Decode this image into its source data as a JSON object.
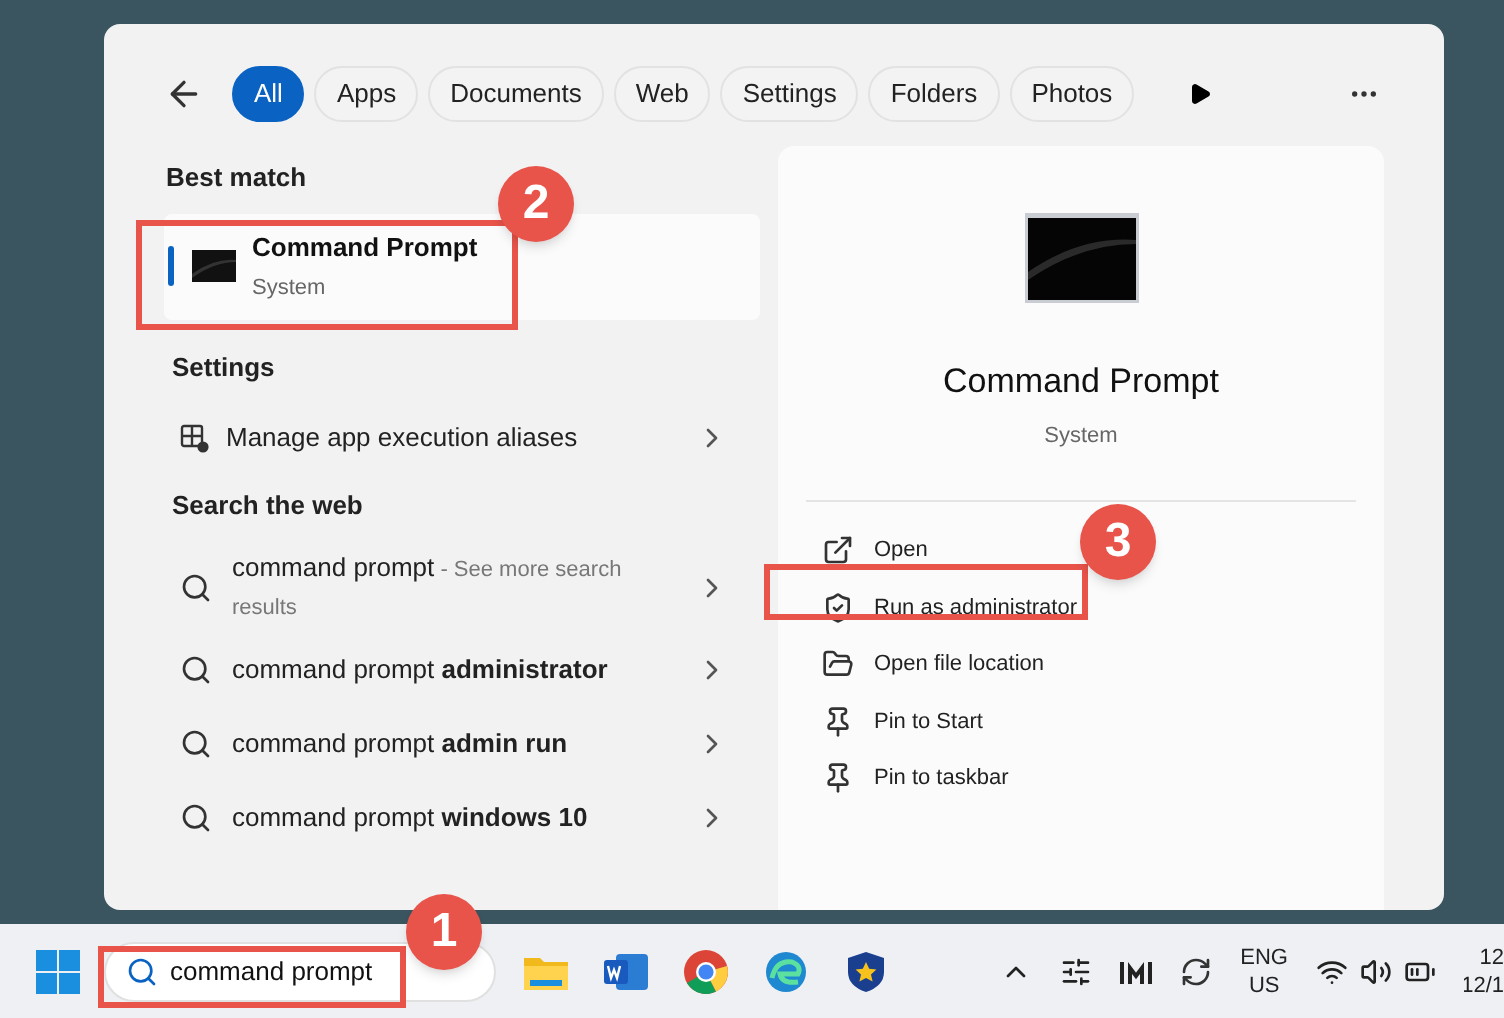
{
  "filters": [
    {
      "label": "All",
      "selected": true
    },
    {
      "label": "Apps",
      "selected": false
    },
    {
      "label": "Documents",
      "selected": false
    },
    {
      "label": "Web",
      "selected": false
    },
    {
      "label": "Settings",
      "selected": false
    },
    {
      "label": "Folders",
      "selected": false
    },
    {
      "label": "Photos",
      "selected": false
    }
  ],
  "best_match": {
    "heading": "Best match",
    "title": "Command Prompt",
    "subtitle": "System",
    "selected": true
  },
  "settings": {
    "heading": "Settings",
    "items": [
      {
        "label": "Manage app execution aliases"
      }
    ]
  },
  "web": {
    "heading": "Search the web",
    "items": [
      {
        "text": "command prompt",
        "hint": " - See more search results"
      },
      {
        "text": "command prompt **administrator**"
      },
      {
        "text": "command prompt **admin run**"
      },
      {
        "text": "command prompt **windows 10**"
      }
    ]
  },
  "details": {
    "title": "Command Prompt",
    "subtitle": "System",
    "actions": [
      {
        "kind": "open",
        "label": "Open"
      },
      {
        "kind": "admin",
        "label": "Run as administrator"
      },
      {
        "kind": "folder",
        "label": "Open file location"
      },
      {
        "kind": "pin",
        "label": "Pin to Start"
      },
      {
        "kind": "pin",
        "label": "Pin to taskbar"
      }
    ]
  },
  "taskbar": {
    "search_value": "command prompt",
    "language": [
      "ENG",
      "US"
    ],
    "clock": [
      "12",
      "12/1"
    ]
  },
  "callouts": [
    {
      "number": "1"
    },
    {
      "number": "2"
    },
    {
      "number": "3"
    }
  ]
}
